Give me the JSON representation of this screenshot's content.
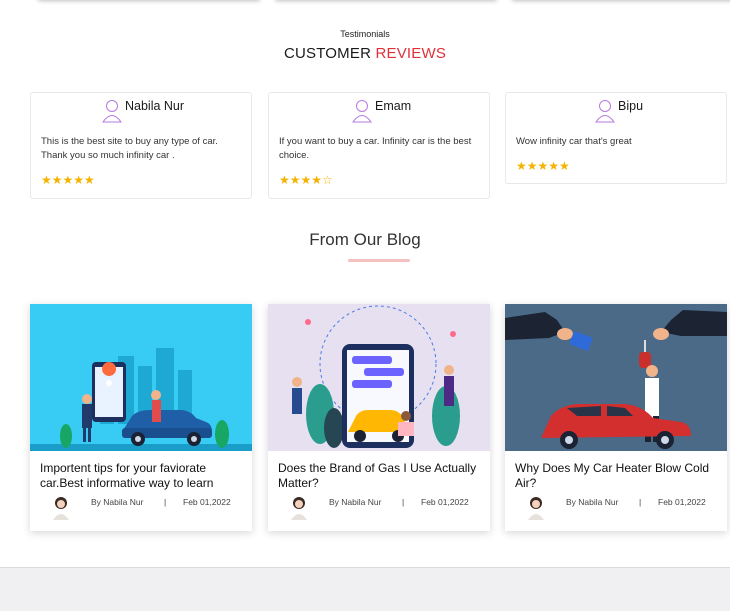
{
  "testimonials": {
    "eyebrow": "Testimonials",
    "title_main": "CUSTOMER",
    "title_accent": "REVIEWS",
    "reviews": [
      {
        "name": "Nabila Nur",
        "text": "This is the best site to buy any type of car. Thank you so much infinity car .",
        "rating": 5,
        "stars": "★★★★★"
      },
      {
        "name": "Emam",
        "text": "If you want to buy a car. Infinity car is the best choice.",
        "rating": 4,
        "stars": "★★★★",
        "stars_empty": "☆"
      },
      {
        "name": "Bipu",
        "text": "Wow infinity car that's great",
        "rating": 5,
        "stars": "★★★★★"
      }
    ]
  },
  "blog": {
    "title": "From Our Blog",
    "posts": [
      {
        "title": "Importent tips for your faviorate car.Best informative way to learn",
        "author": "By Nabila Nur",
        "separator": "|",
        "date": "Feb 01,2022",
        "image_icon": "car-navigation-illustration-icon"
      },
      {
        "title": "Does the Brand of Gas I Use Actually Matter?",
        "author": "By Nabila Nur",
        "separator": "|",
        "date": "Feb 01,2022",
        "image_icon": "phone-car-app-illustration-icon"
      },
      {
        "title": "Why Does My Car Heater Blow Cold Air?",
        "author": "By Nabila Nur",
        "separator": "|",
        "date": "Feb 01,2022",
        "image_icon": "car-key-handover-illustration-icon"
      }
    ]
  },
  "colors": {
    "accent": "#e0303a",
    "star": "#f5b301",
    "user_icon": "#b77adf",
    "underline": "#f4c0c0"
  }
}
